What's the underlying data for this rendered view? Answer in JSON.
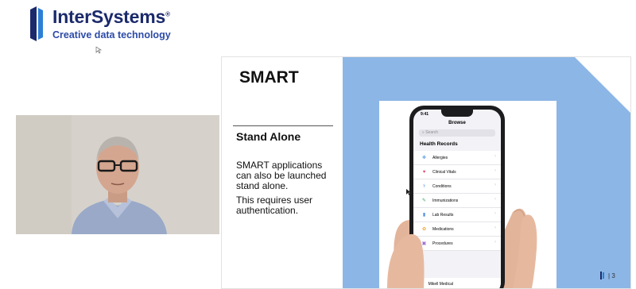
{
  "brand": {
    "name": "InterSystems",
    "trademark": "®",
    "tagline": "Creative data technology",
    "colors": {
      "navy": "#1b2a6b",
      "blue": "#2c4aa8",
      "accent": "#0066cc"
    }
  },
  "slide": {
    "title": "SMART",
    "subtitle": "Stand Alone",
    "paragraphs": [
      "SMART applications can also be launched stand alone.",
      "This requires user authentication."
    ],
    "page_number": "3",
    "panel_color": "#8cb6e6"
  },
  "phone": {
    "time": "9:41",
    "title": "Browse",
    "search_placeholder": "Search",
    "section_title": "Health Records",
    "records": [
      {
        "label": "Allergies",
        "icon": "allergy-icon",
        "glyph": "✻",
        "color": "#4a8fe0"
      },
      {
        "label": "Clinical Vitals",
        "icon": "vitals-icon",
        "glyph": "♥",
        "color": "#e24a6a"
      },
      {
        "label": "Conditions",
        "icon": "stethoscope-icon",
        "glyph": "⚕",
        "color": "#4a8fe0"
      },
      {
        "label": "Immunizations",
        "icon": "syringe-icon",
        "glyph": "✎",
        "color": "#3aa56a"
      },
      {
        "label": "Lab Results",
        "icon": "lab-icon",
        "glyph": "▮",
        "color": "#4a8fe0"
      },
      {
        "label": "Medications",
        "icon": "pill-icon",
        "glyph": "✿",
        "color": "#f0a030"
      },
      {
        "label": "Procedures",
        "icon": "procedure-icon",
        "glyph": "▣",
        "color": "#a070d0"
      }
    ],
    "provider": "Mikell Medical"
  }
}
